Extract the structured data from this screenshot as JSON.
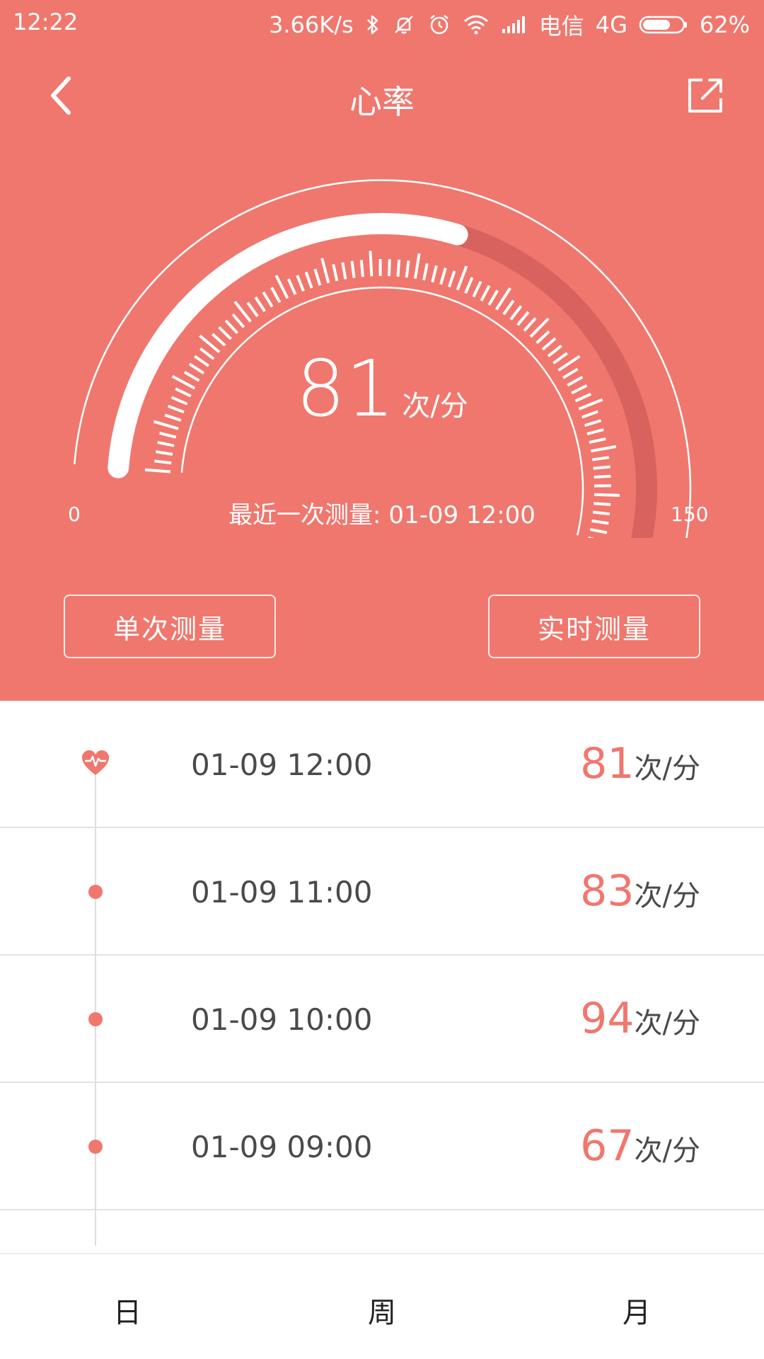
{
  "status_bar": {
    "time": "12:22",
    "network_speed": "3.66K/s",
    "carrier": "电信",
    "network_type": "4G",
    "battery": "62%",
    "icons": [
      "bluetooth-icon",
      "mute-icon",
      "alarm-icon",
      "wifi-icon",
      "signal-icon",
      "battery-icon"
    ]
  },
  "header": {
    "title": "心率",
    "back_icon": "chevron-left-icon",
    "share_icon": "share-icon"
  },
  "gauge": {
    "value": "81",
    "unit": "次/分",
    "min_label": "0",
    "max_label": "150",
    "min": 0,
    "max": 150,
    "level": 81,
    "last_measure": "最近一次测量: 01-09 12:00"
  },
  "buttons": {
    "single": "单次测量",
    "realtime": "实时测量"
  },
  "history": [
    {
      "time": "01-09 12:00",
      "value": "81",
      "unit": "次/分",
      "marker": "heart-pulse-icon"
    },
    {
      "time": "01-09 11:00",
      "value": "83",
      "unit": "次/分",
      "marker": "dot"
    },
    {
      "time": "01-09 10:00",
      "value": "94",
      "unit": "次/分",
      "marker": "dot"
    },
    {
      "time": "01-09 09:00",
      "value": "67",
      "unit": "次/分",
      "marker": "dot"
    }
  ],
  "tabs": {
    "day": "日",
    "week": "周",
    "month": "月"
  },
  "colors": {
    "accent": "#F0776E",
    "gauge_track": "#D8635E",
    "text": "#4a4a4a"
  }
}
